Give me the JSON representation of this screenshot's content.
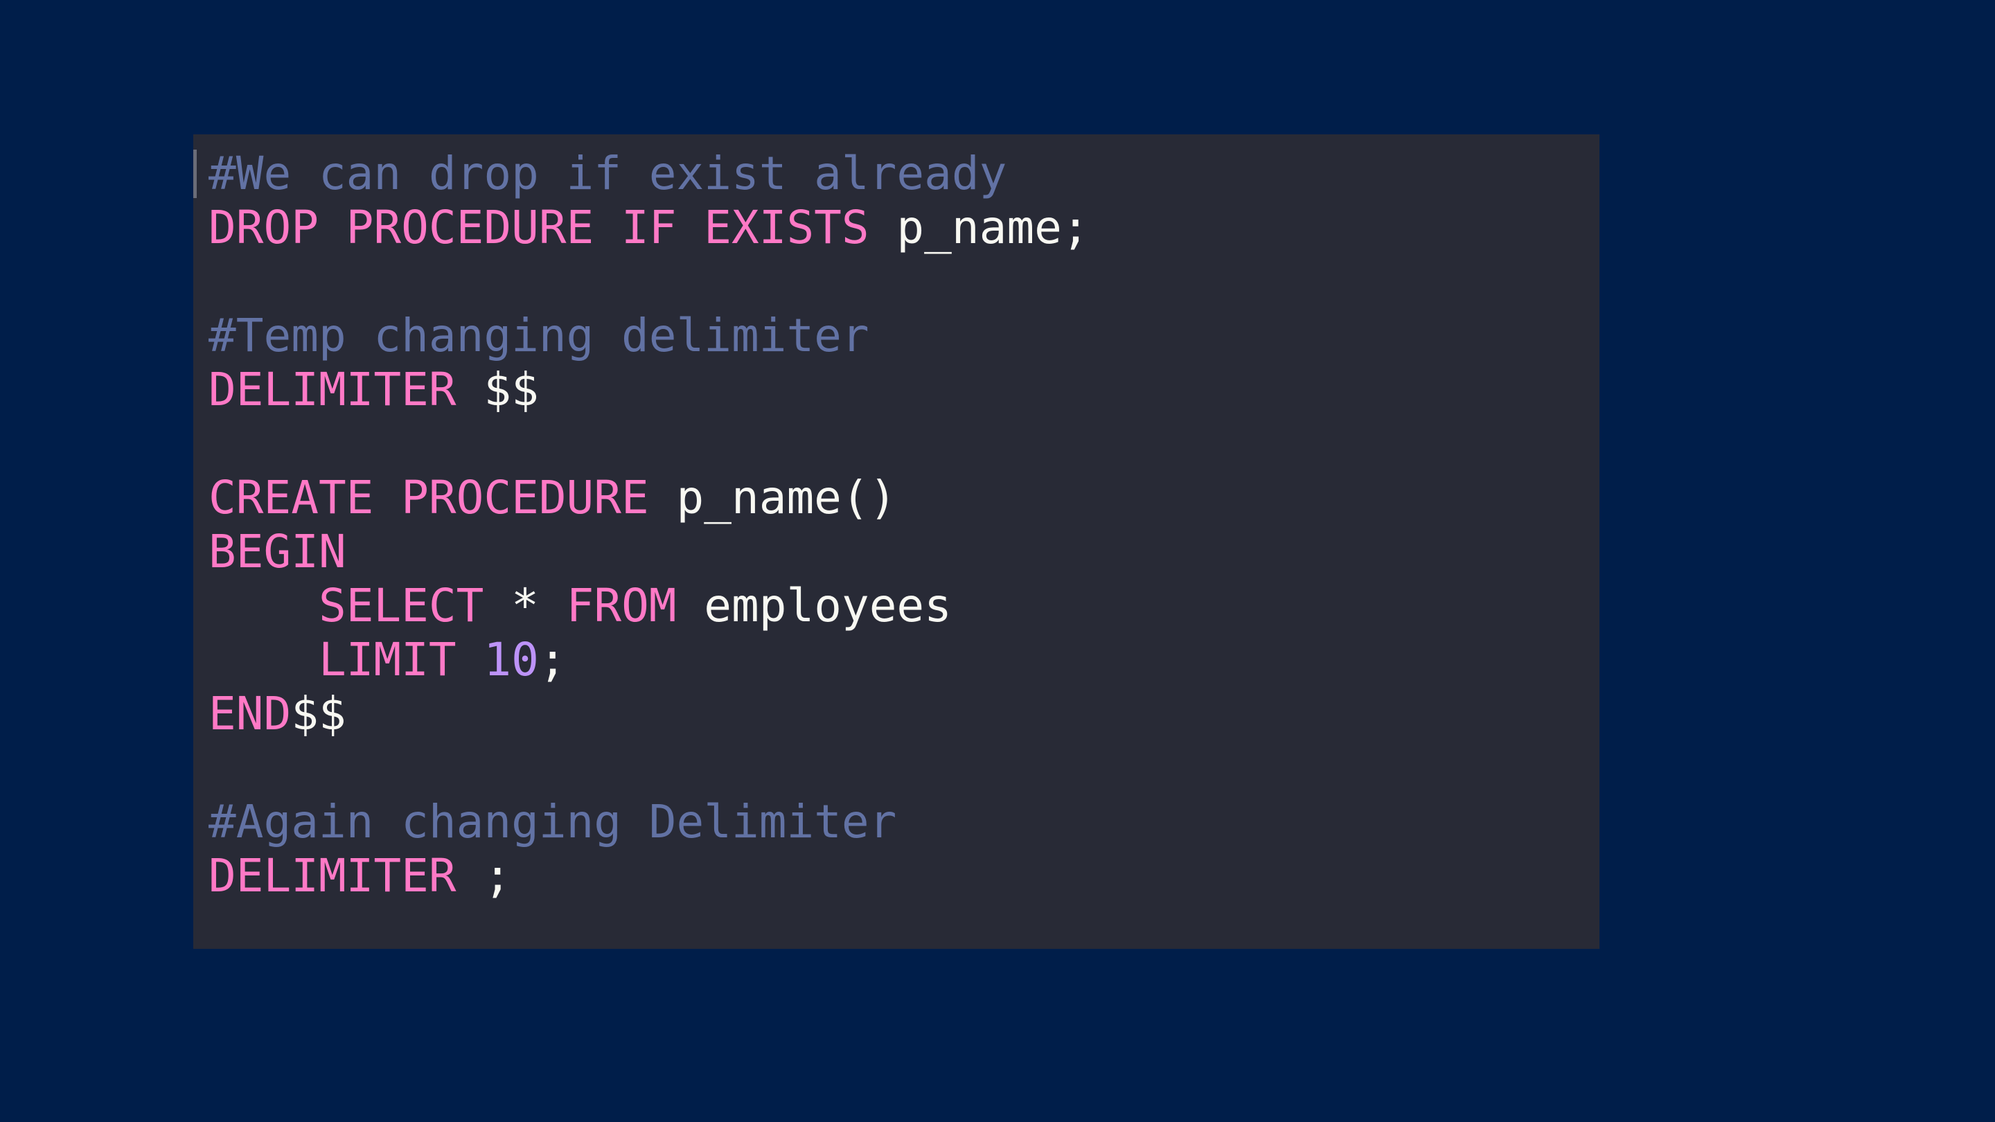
{
  "colors": {
    "background": "#001e4a",
    "editor_background": "#282a36",
    "keyword": "#ff79c6",
    "comment": "#6272a4",
    "plain": "#f8f8f2",
    "number": "#bd93f9"
  },
  "code": {
    "language": "SQL",
    "lines": [
      [
        {
          "t": "#We can drop if exist already",
          "k": "comment"
        }
      ],
      [
        {
          "t": "DROP PROCEDURE IF EXISTS",
          "k": "keyword"
        },
        {
          "t": " p_name;",
          "k": "plain"
        }
      ],
      [],
      [
        {
          "t": "#Temp changing delimiter",
          "k": "comment"
        }
      ],
      [
        {
          "t": "DELIMITER",
          "k": "keyword"
        },
        {
          "t": " $$",
          "k": "plain"
        }
      ],
      [],
      [
        {
          "t": "CREATE PROCEDURE",
          "k": "keyword"
        },
        {
          "t": " p_name()",
          "k": "plain"
        }
      ],
      [
        {
          "t": "BEGIN",
          "k": "keyword"
        }
      ],
      [
        {
          "t": "    ",
          "k": "plain"
        },
        {
          "t": "SELECT",
          "k": "keyword"
        },
        {
          "t": " * ",
          "k": "plain"
        },
        {
          "t": "FROM",
          "k": "keyword"
        },
        {
          "t": " employees",
          "k": "plain"
        }
      ],
      [
        {
          "t": "    ",
          "k": "plain"
        },
        {
          "t": "LIMIT",
          "k": "keyword"
        },
        {
          "t": " ",
          "k": "plain"
        },
        {
          "t": "10",
          "k": "number"
        },
        {
          "t": ";",
          "k": "plain"
        }
      ],
      [
        {
          "t": "END",
          "k": "keyword"
        },
        {
          "t": "$$",
          "k": "plain"
        }
      ],
      [],
      [
        {
          "t": "#Again changing Delimiter",
          "k": "comment"
        }
      ],
      [
        {
          "t": "DELIMITER",
          "k": "keyword"
        },
        {
          "t": " ;",
          "k": "plain"
        }
      ]
    ]
  }
}
